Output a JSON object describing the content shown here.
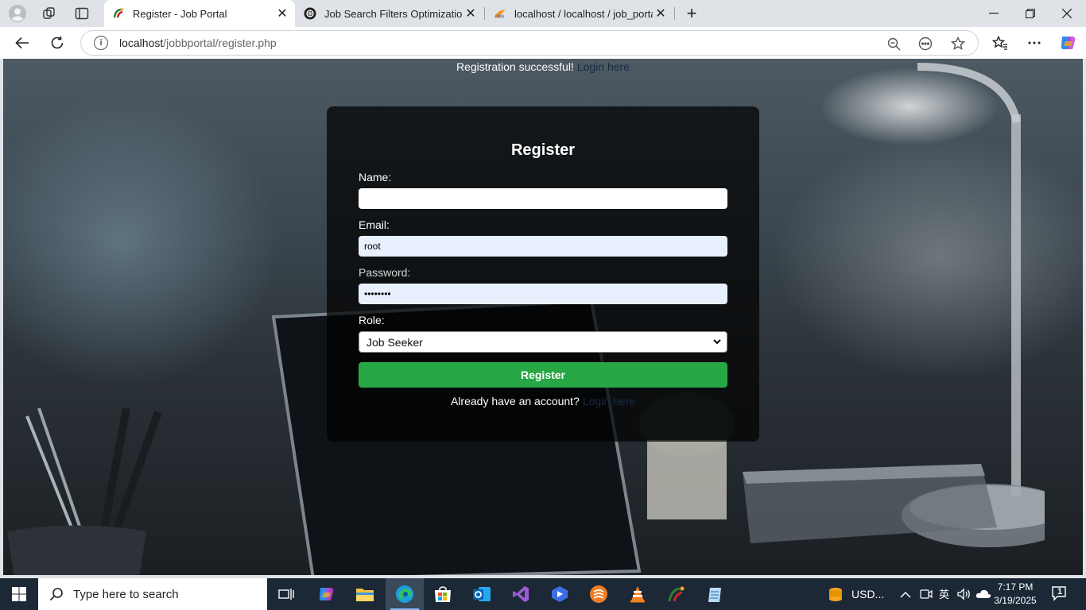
{
  "browser": {
    "tabs": [
      {
        "label": "Register - Job Portal",
        "favicon": "job-portal-favicon",
        "active": true
      },
      {
        "label": "Job Search Filters Optimization",
        "favicon": "chatgpt-favicon",
        "active": false
      },
      {
        "label": "localhost / localhost / job_portal /",
        "favicon": "phpmyadmin-favicon",
        "active": false
      }
    ],
    "url_host": "localhost",
    "url_path": "/jobbportal/register.php"
  },
  "page": {
    "flash_message": "Registration successful!",
    "flash_link": "Login here",
    "form": {
      "title": "Register",
      "name_label": "Name:",
      "name_value": "",
      "email_label": "Email:",
      "email_value": "root",
      "password_label": "Password:",
      "password_value": "••••••••",
      "role_label": "Role:",
      "role_selected": "Job Seeker",
      "submit_label": "Register",
      "already_text": "Already have an account?",
      "already_link": "Login here"
    }
  },
  "taskbar": {
    "search_placeholder": "Type here to search",
    "weather_text": "USD...",
    "time": "7:17 PM",
    "date": "3/19/2025",
    "notification_count": "1"
  },
  "colors": {
    "submit_green": "#28a745",
    "taskbar_bg": "#1c2836",
    "tab_strip_bg": "#dfe3e8"
  }
}
